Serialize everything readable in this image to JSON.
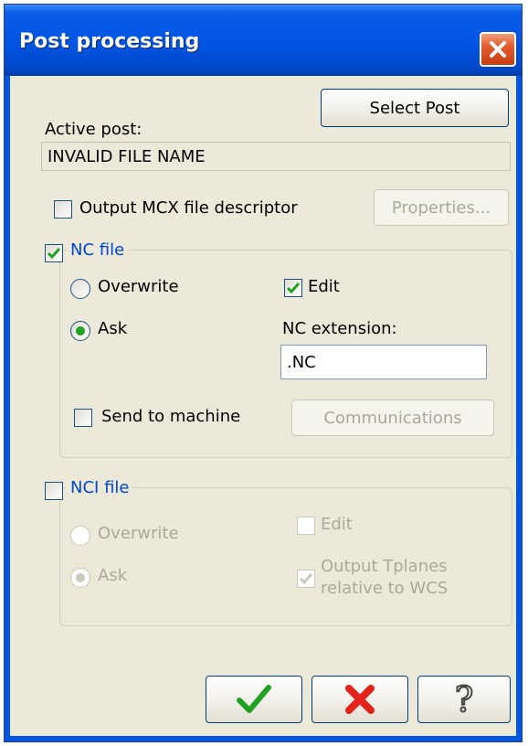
{
  "window": {
    "title": "Post processing"
  },
  "active_post": {
    "label": "Active post:",
    "select_button": "Select Post",
    "value": "INVALID FILE NAME"
  },
  "mcx": {
    "checkbox_label": "Output MCX file descriptor",
    "checked": false,
    "properties_button": "Properties..."
  },
  "nc_file": {
    "group_label": "NC file",
    "checked": true,
    "overwrite_label": "Overwrite",
    "ask_label": "Ask",
    "selected": "Ask",
    "edit_label": "Edit",
    "edit_checked": true,
    "extension_label": "NC extension:",
    "extension_value": ".NC",
    "send_label": "Send to machine",
    "send_checked": false,
    "communications_button": "Communications"
  },
  "nci_file": {
    "group_label": "NCI file",
    "checked": false,
    "overwrite_label": "Overwrite",
    "ask_label": "Ask",
    "selected": "Ask",
    "edit_label": "Edit",
    "edit_checked": false,
    "tplanes_label_line1": "Output Tplanes",
    "tplanes_label_line2": "relative to WCS",
    "tplanes_checked": true
  },
  "footer": {
    "ok_icon": "green-check-icon",
    "cancel_icon": "red-x-icon",
    "help_icon": "question-mark-icon"
  },
  "colors": {
    "title_bar": "#0054e3",
    "dialog_bg": "#ece9d8",
    "group_label": "#0046d5",
    "check_green": "#21a121",
    "cancel_red": "#e3221b"
  }
}
